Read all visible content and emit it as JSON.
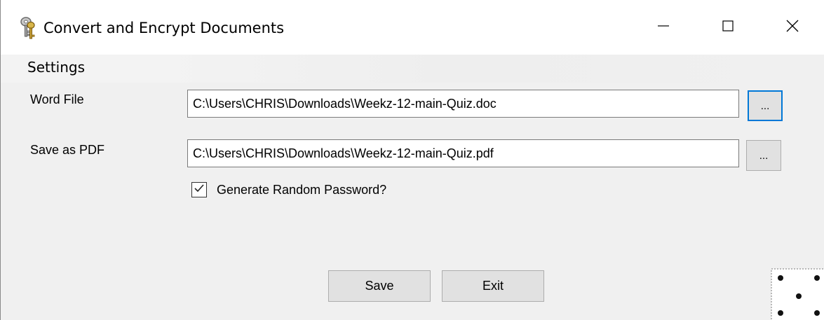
{
  "window": {
    "title": "Convert and Encrypt Documents",
    "icon": "keys-icon",
    "controls": {
      "minimize_icon": "minimize-icon",
      "maximize_icon": "maximize-icon",
      "close_icon": "close-icon"
    }
  },
  "menu": {
    "items": [
      "Settings"
    ]
  },
  "form": {
    "word_file": {
      "label": "Word File",
      "value": "C:\\Users\\CHRIS\\Downloads\\Weekz-12-main-Quiz.doc",
      "browse_label": "..."
    },
    "save_pdf": {
      "label": "Save as PDF",
      "value": "C:\\Users\\CHRIS\\Downloads\\Weekz-12-main-Quiz.pdf",
      "browse_label": "..."
    },
    "generate_password": {
      "label": "Generate Random Password?",
      "checked": true
    }
  },
  "buttons": {
    "save": "Save",
    "exit": "Exit"
  },
  "colors": {
    "focus_accent": "#0078d7",
    "window_bg": "#f0f0f0",
    "button_bg": "#e1e1e1"
  },
  "decor": {
    "corner_image": "dice-icon"
  }
}
